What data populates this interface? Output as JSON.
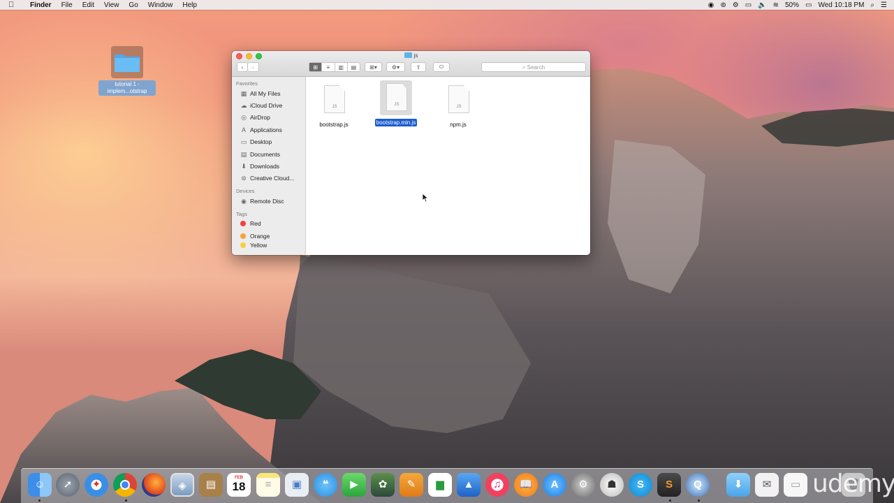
{
  "menubar": {
    "apple_icon": "apple-icon",
    "app_name": "Finder",
    "menus": [
      "File",
      "Edit",
      "View",
      "Go",
      "Window",
      "Help"
    ],
    "battery": "50%",
    "clock": "Wed 10:18 PM",
    "status_icons": [
      "record-icon",
      "creative-cloud-icon",
      "vpn-icon",
      "airplay-icon",
      "volume-icon",
      "wifi-icon",
      "battery-icon",
      "spotlight-icon",
      "notification-center-icon"
    ]
  },
  "desktop": {
    "folder_label_line1": "tutorial 1 -",
    "folder_label_line2": "implem...otstrap"
  },
  "finder": {
    "title": "js",
    "search_placeholder": "Search",
    "nav_back": "‹",
    "nav_forward": "›",
    "sidebar": {
      "favorites_header": "Favorites",
      "favorites": [
        {
          "label": "All My Files",
          "icon": "all-files-icon"
        },
        {
          "label": "iCloud Drive",
          "icon": "cloud-icon"
        },
        {
          "label": "AirDrop",
          "icon": "airdrop-icon"
        },
        {
          "label": "Applications",
          "icon": "applications-icon"
        },
        {
          "label": "Desktop",
          "icon": "desktop-icon"
        },
        {
          "label": "Documents",
          "icon": "documents-icon"
        },
        {
          "label": "Downloads",
          "icon": "downloads-icon"
        },
        {
          "label": "Creative Cloud...",
          "icon": "creative-cloud-icon"
        }
      ],
      "devices_header": "Devices",
      "devices": [
        {
          "label": "Remote Disc",
          "icon": "disc-icon"
        }
      ],
      "tags_header": "Tags",
      "tags": [
        {
          "label": "Red",
          "color": "#f0443a"
        },
        {
          "label": "Orange",
          "color": "#f5a33a"
        },
        {
          "label": "Yellow",
          "color": "#f7cf3b"
        }
      ]
    },
    "files": [
      {
        "name": "bootstrap.js",
        "ext": "JS",
        "selected": false
      },
      {
        "name": "bootstrap.min.js",
        "ext": "JS",
        "selected": true
      },
      {
        "name": "npm.js",
        "ext": "JS",
        "selected": false
      }
    ]
  },
  "dock": {
    "apps": [
      "Finder",
      "Launchpad",
      "Safari",
      "Chrome",
      "Firefox",
      "Preview",
      "Notefile",
      "Calendar",
      "Notes",
      "Photo Booth",
      "Messages",
      "FaceTime",
      "Photos",
      "Pages",
      "Numbers",
      "Keynote",
      "iTunes",
      "iBooks",
      "App Store",
      "System Preferences",
      "Sequel",
      "Skype",
      "Sublime Text",
      "QuickTime",
      "Downloads",
      "Mail Doc",
      "Document"
    ],
    "calendar_month": "FEB",
    "calendar_day": "18"
  },
  "watermark": "udemy"
}
